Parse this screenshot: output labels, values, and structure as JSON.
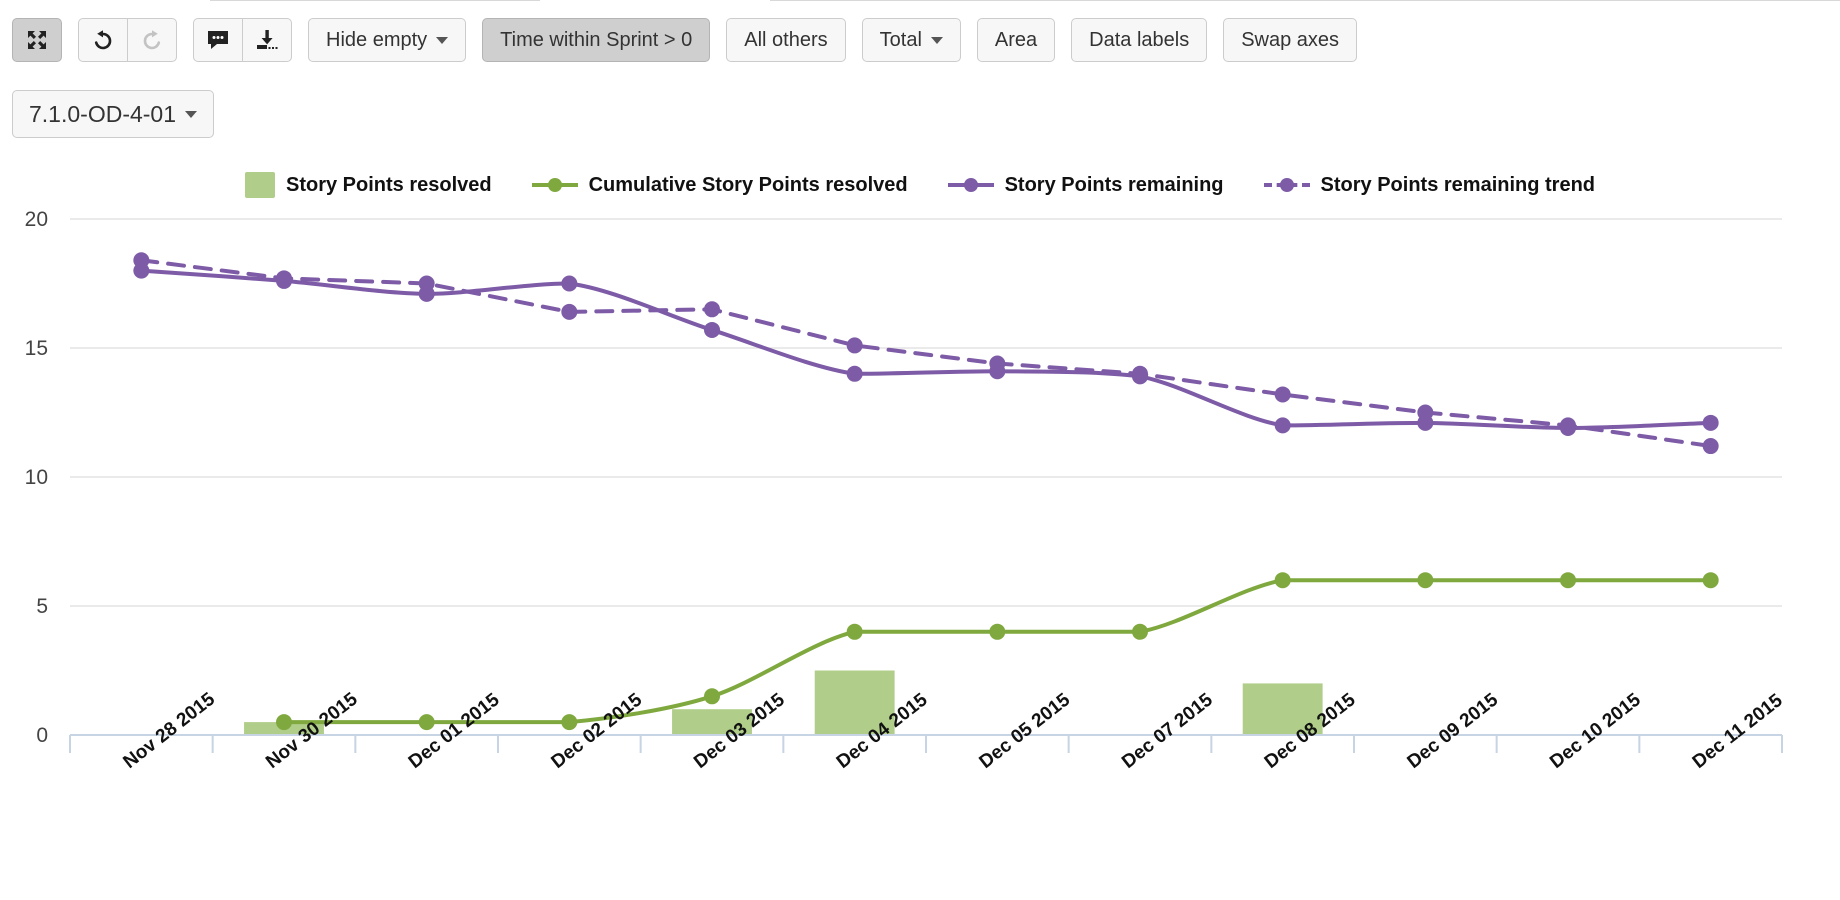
{
  "toolbar": {
    "groups": [
      {
        "name": "expand",
        "buttons": [
          {
            "id": "expand",
            "icon": "expand-arrows-icon",
            "label": "",
            "pressed": true
          }
        ]
      },
      {
        "name": "history",
        "buttons": [
          {
            "id": "undo",
            "icon": "undo-icon",
            "label": "",
            "pressed": false
          },
          {
            "id": "redo",
            "icon": "redo-icon",
            "label": "",
            "pressed": false,
            "disabled": true
          }
        ]
      },
      {
        "name": "share",
        "buttons": [
          {
            "id": "comment",
            "icon": "comment-bubble-icon",
            "label": "",
            "pressed": false
          },
          {
            "id": "download",
            "icon": "download-icon",
            "label": "",
            "pressed": false
          }
        ]
      }
    ],
    "hide_empty_label": "Hide empty",
    "time_within_sprint_label": "Time within Sprint > 0",
    "all_others_label": "All others",
    "total_label": "Total",
    "area_label": "Area",
    "data_labels_label": "Data labels",
    "swap_axes_label": "Swap axes"
  },
  "filter_row": {
    "version_label": "7.1.0-OD-4-01"
  },
  "colors": {
    "bar_green": "#b0ce8a",
    "line_green": "#7fa93f",
    "purple": "#7d5ba6",
    "grid": "#e4e4e4",
    "axis": "#c6d4e4",
    "accent_pressed": "#cfcfcf"
  },
  "chart_data": {
    "type": "bar",
    "title": "",
    "xlabel": "",
    "ylabel": "",
    "ylim": [
      0,
      20
    ],
    "yticks": [
      0,
      5,
      10,
      15,
      20
    ],
    "grid": true,
    "legend_position": "top-center",
    "categories": [
      "Nov 28 2015",
      "Nov 30 2015",
      "Dec 01 2015",
      "Dec 02 2015",
      "Dec 03 2015",
      "Dec 04 2015",
      "Dec 05 2015",
      "Dec 07 2015",
      "Dec 08 2015",
      "Dec 09 2015",
      "Dec 10 2015",
      "Dec 11 2015"
    ],
    "series": [
      {
        "name": "Story Points resolved",
        "type": "bar",
        "color": "#b0ce8a",
        "values": [
          0,
          0.5,
          0,
          0,
          1,
          2.5,
          0,
          0,
          2,
          0,
          0,
          0
        ]
      },
      {
        "name": "Cumulative Story Points resolved",
        "type": "line",
        "color": "#7fa93f",
        "dashed": false,
        "values": [
          null,
          0.5,
          0.5,
          0.5,
          1.5,
          4,
          4,
          4,
          6,
          6,
          6,
          6
        ]
      },
      {
        "name": "Story Points remaining",
        "type": "line",
        "color": "#7d5ba6",
        "dashed": false,
        "values": [
          18.0,
          17.6,
          17.1,
          17.5,
          15.7,
          14.0,
          14.1,
          13.9,
          12.0,
          12.1,
          11.9,
          12.1
        ]
      },
      {
        "name": "Story Points remaining trend",
        "type": "line",
        "color": "#7d5ba6",
        "dashed": true,
        "values": [
          18.4,
          17.7,
          17.5,
          16.4,
          16.5,
          15.1,
          14.4,
          14.0,
          13.2,
          12.5,
          12.0,
          11.2
        ]
      }
    ]
  }
}
